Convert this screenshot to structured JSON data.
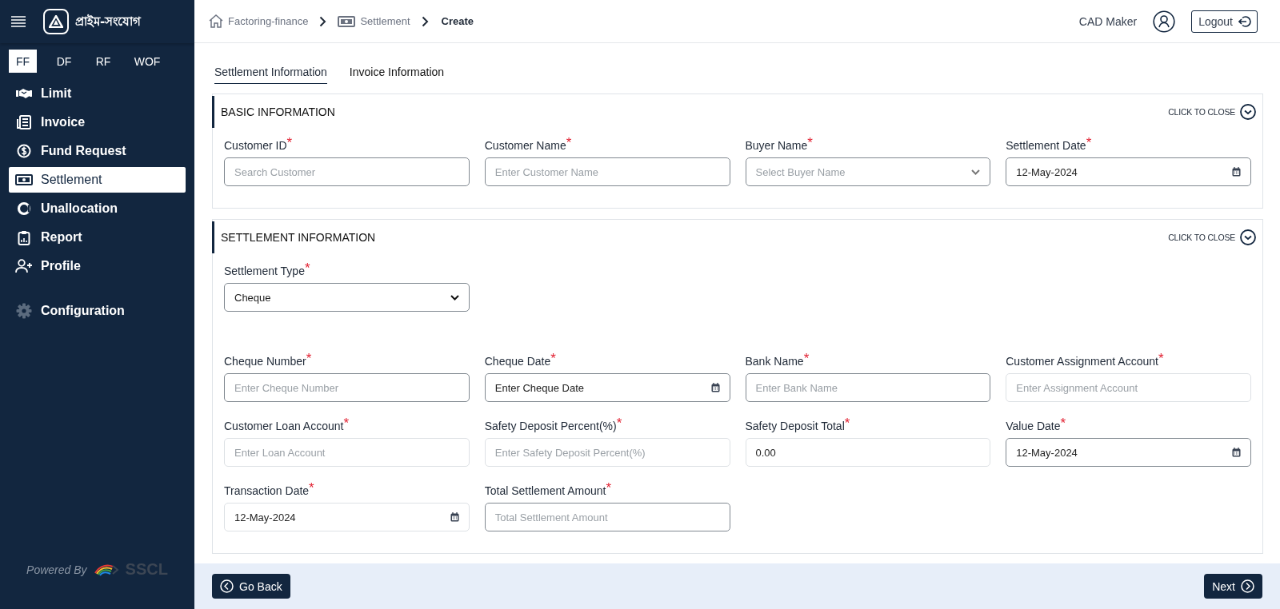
{
  "sidebar": {
    "brand": "প্রাইম-সংযোগ",
    "modules": [
      {
        "label": "FF",
        "selected": true
      },
      {
        "label": "DF",
        "selected": false
      },
      {
        "label": "RF",
        "selected": false
      },
      {
        "label": "WOF",
        "selected": false
      }
    ],
    "nav": [
      {
        "label": "Limit",
        "kind": "handshake",
        "selected": false
      },
      {
        "label": "Invoice",
        "kind": "document",
        "selected": false
      },
      {
        "label": "Fund Request",
        "kind": "dollar",
        "selected": false
      },
      {
        "label": "Settlement",
        "kind": "banknote",
        "selected": true
      },
      {
        "label": "Unallocation",
        "kind": "ring",
        "selected": false
      },
      {
        "label": "Report",
        "kind": "clipboard",
        "selected": false
      },
      {
        "label": "Profile",
        "kind": "user-plus",
        "selected": false
      },
      {
        "label": "Configuration",
        "kind": "gear",
        "selected": false
      }
    ],
    "powered_by": "Powered By",
    "vendor": "SSCL"
  },
  "breadcrumb": [
    {
      "label": "Factoring-finance",
      "kind": "home",
      "current": false
    },
    {
      "label": "Settlement",
      "kind": "banknote",
      "current": false
    },
    {
      "label": "Create",
      "kind": "none",
      "current": true
    }
  ],
  "user": {
    "name": "CAD Maker"
  },
  "logout": "Logout",
  "tabs": [
    {
      "label": "Settlement Information",
      "selected": true
    },
    {
      "label": "Invoice Information",
      "selected": false
    }
  ],
  "required_mark": "*",
  "sections": [
    {
      "title": "BASIC INFORMATION",
      "toggle": "CLICK TO CLOSE",
      "rows": [
        [
          {
            "label": "Customer ID",
            "required": true,
            "kind": "text",
            "placeholder": "Search Customer",
            "disabled": false
          },
          {
            "label": "Customer Name",
            "required": true,
            "kind": "text",
            "placeholder": "Enter Customer Name",
            "disabled": false
          },
          {
            "label": "Buyer Name",
            "required": true,
            "kind": "select",
            "placeholder": "Select Buyer Name",
            "disabled": false
          },
          {
            "label": "Settlement Date",
            "required": true,
            "kind": "date",
            "value": "12-May-2024",
            "disabled": false
          }
        ]
      ]
    },
    {
      "title": "SETTLEMENT INFORMATION",
      "toggle": "CLICK TO CLOSE",
      "rows": [
        [
          {
            "label": "Settlement Type",
            "required": true,
            "kind": "select",
            "value": "Cheque",
            "disabled": false
          }
        ],
        [
          {
            "label": "Cheque Number",
            "required": true,
            "kind": "text",
            "placeholder": "Enter Cheque Number",
            "disabled": false
          },
          {
            "label": "Cheque Date",
            "required": true,
            "kind": "date",
            "value": "Enter Cheque Date",
            "disabled": false
          },
          {
            "label": "Bank Name",
            "required": true,
            "kind": "text",
            "placeholder": "Enter Bank Name",
            "disabled": false
          },
          {
            "label": "Customer Assignment Account",
            "required": true,
            "kind": "text",
            "placeholder": "Enter Assignment Account",
            "disabled": true
          }
        ],
        [
          {
            "label": "Customer Loan Account",
            "required": true,
            "kind": "text",
            "placeholder": "Enter Loan Account",
            "disabled": true
          },
          {
            "label": "Safety Deposit Percent(%)",
            "required": true,
            "kind": "text",
            "placeholder": "Enter Safety Deposit Percent(%)",
            "disabled": true
          },
          {
            "label": "Safety Deposit Total",
            "required": true,
            "kind": "text",
            "value": "0.00",
            "disabled": true
          },
          {
            "label": "Value Date",
            "required": true,
            "kind": "date",
            "value": "12-May-2024",
            "disabled": false
          }
        ],
        [
          {
            "label": "Transaction Date",
            "required": true,
            "kind": "date",
            "value": "12-May-2024",
            "disabled": true
          },
          {
            "label": "Total Settlement Amount",
            "required": true,
            "kind": "text",
            "placeholder": "Total Settlement Amount",
            "disabled": false
          }
        ]
      ]
    }
  ],
  "footer": {
    "back": "Go Back",
    "next": "Next"
  }
}
